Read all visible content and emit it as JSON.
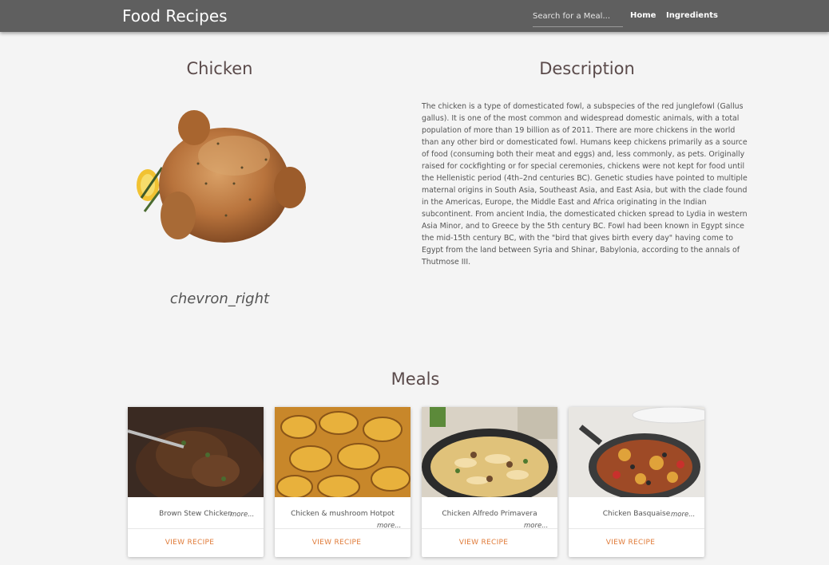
{
  "header": {
    "brand": "Food Recipes",
    "search_placeholder": "Search for a Meal...",
    "nav": {
      "home": "Home",
      "ingredients": "Ingredients"
    }
  },
  "ingredient": {
    "name": "Chicken",
    "chevron_text": "chevron_right",
    "description_title": "Description",
    "description": "The chicken is a type of domesticated fowl, a subspecies of the red junglefowl (Gallus gallus). It is one of the most common and widespread domestic animals, with a total population of more than 19 billion as of 2011. There are more chickens in the world than any other bird or domesticated fowl. Humans keep chickens primarily as a source of food (consuming both their meat and eggs) and, less commonly, as pets. Originally raised for cockfighting or for special ceremonies, chickens were not kept for food until the Hellenistic period (4th–2nd centuries BC). Genetic studies have pointed to multiple maternal origins in South Asia, Southeast Asia, and East Asia, but with the clade found in the Americas, Europe, the Middle East and Africa originating in the Indian subcontinent. From ancient India, the domesticated chicken spread to Lydia in western Asia Minor, and to Greece by the 5th century BC. Fowl had been known in Egypt since the mid-15th century BC, with the \"bird that gives birth every day\" having come to Egypt from the land between Syria and Shinar, Babylonia, according to the annals of Thutmose III."
  },
  "meals": {
    "title": "Meals",
    "items": [
      {
        "name": "Brown Stew Chicken",
        "more": "more...",
        "action": "VIEW RECIPE"
      },
      {
        "name": "Chicken & mushroom Hotpot",
        "more": "more...",
        "action": "VIEW RECIPE"
      },
      {
        "name": "Chicken Alfredo Primavera",
        "more": "more...",
        "action": "VIEW RECIPE"
      },
      {
        "name": "Chicken Basquaise",
        "more": "more...",
        "action": "VIEW RECIPE"
      }
    ]
  }
}
